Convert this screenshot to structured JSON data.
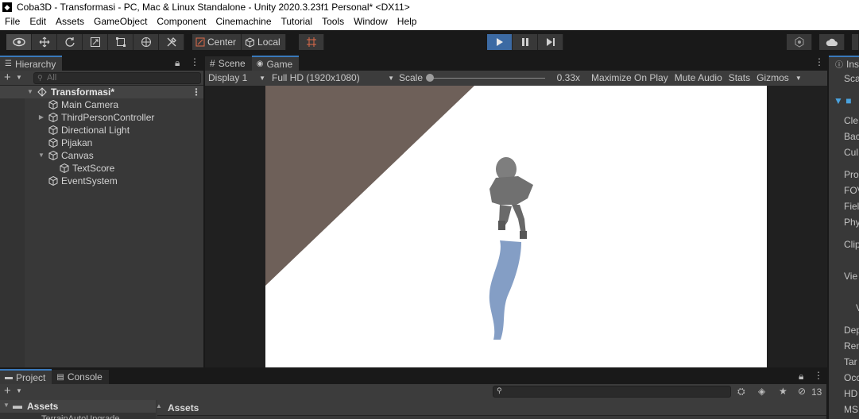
{
  "window": {
    "title": "Coba3D - Transformasi - PC, Mac & Linux Standalone - Unity 2020.3.23f1 Personal* <DX11>"
  },
  "menu": [
    "File",
    "Edit",
    "Assets",
    "GameObject",
    "Component",
    "Cinemachine",
    "Tutorial",
    "Tools",
    "Window",
    "Help"
  ],
  "toolbar": {
    "pivot_label": "Center",
    "space_label": "Local"
  },
  "hierarchy": {
    "tab_label": "Hierarchy",
    "search_placeholder": "All",
    "scene": "Transformasi*",
    "items": [
      {
        "label": "Main Camera"
      },
      {
        "label": "ThirdPersonController"
      },
      {
        "label": "Directional Light"
      },
      {
        "label": "Pijakan"
      },
      {
        "label": "Canvas"
      },
      {
        "label": "TextScore"
      },
      {
        "label": "EventSystem"
      }
    ]
  },
  "game": {
    "scene_tab": "Scene",
    "game_tab": "Game",
    "display": "Display 1",
    "resolution": "Full HD (1920x1080)",
    "scale_label": "Scale",
    "scale_value": "0.33x",
    "scale_fraction": 0.0,
    "maximize": "Maximize On Play",
    "mute": "Mute Audio",
    "stats": "Stats",
    "gizmos": "Gizmos"
  },
  "inspector": {
    "tab_label": "Ins",
    "rows": [
      "Sca",
      "Cle",
      "Bac",
      "Cul",
      "Pro",
      "FOV",
      "Fiel",
      "Phy",
      "Clip",
      "Vie",
      "V",
      "Dep",
      "Ren",
      "Tar",
      "Occ",
      "HD",
      "MS"
    ]
  },
  "project": {
    "project_tab": "Project",
    "console_tab": "Console",
    "assets_folder": "Assets",
    "assets_header": "Assets",
    "hidden_count": "13",
    "partial_item": "TerrainAutoUpgrade"
  },
  "colors": {
    "accent_blue": "#3a79bb",
    "play_active": "#3c6aa3",
    "panel_bg": "#383838"
  }
}
